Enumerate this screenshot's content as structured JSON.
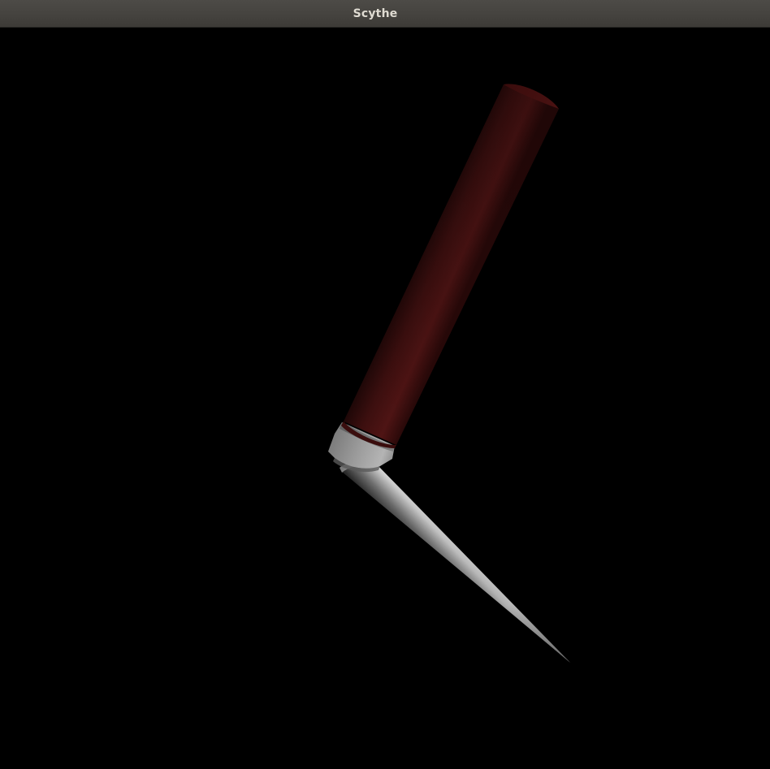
{
  "window": {
    "title": "Scythe"
  },
  "viewport": {
    "background": "#000000"
  },
  "scene": {
    "handle_color": "#5a1414",
    "collar_color": "#9a9a9a",
    "blade_color": "#d0d0d0",
    "icons": [
      "scythe-handle",
      "scythe-collar",
      "scythe-blade"
    ]
  }
}
